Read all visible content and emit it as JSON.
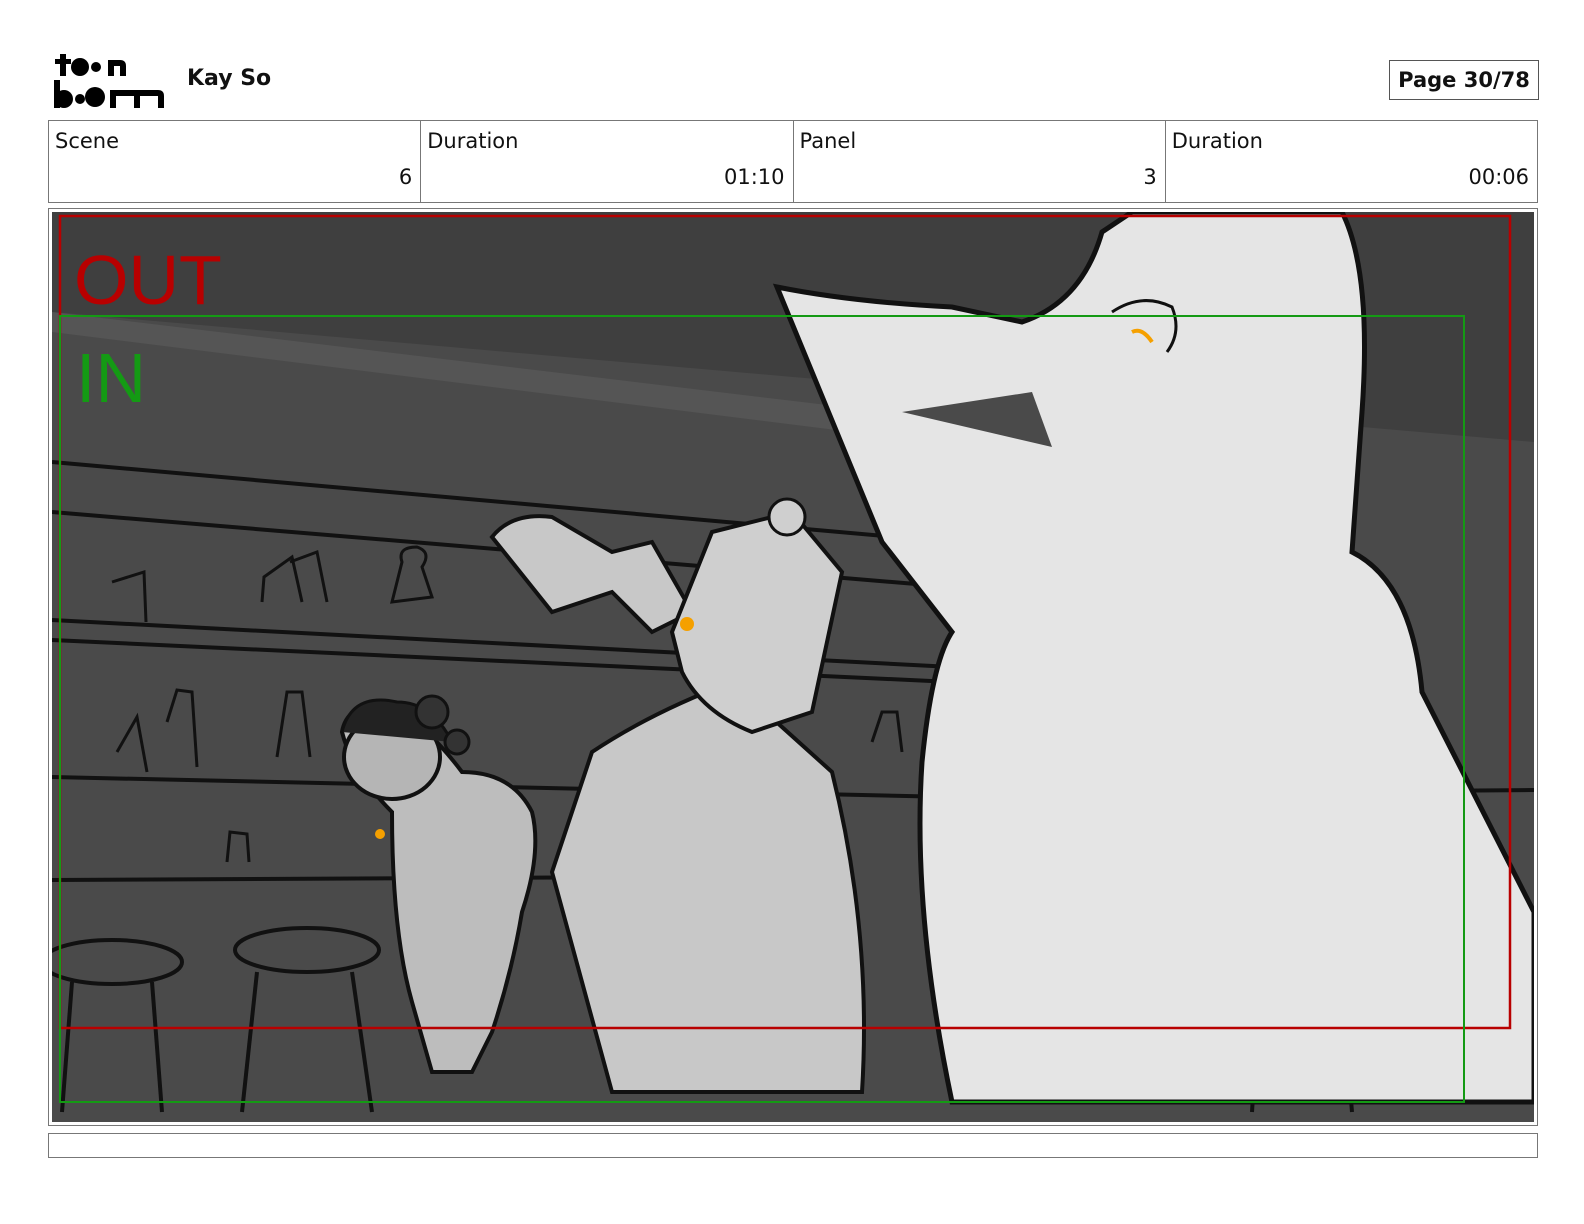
{
  "header": {
    "logo_text": "toon boom",
    "project_name": "Kay So",
    "page_indicator": "Page 30/78"
  },
  "info": {
    "scene_label": "Scene",
    "scene_value": "6",
    "scene_duration_label": "Duration",
    "scene_duration_value": "01:10",
    "panel_label": "Panel",
    "panel_value": "3",
    "panel_duration_label": "Duration",
    "panel_duration_value": "00:06"
  },
  "frame": {
    "out_label": "OUT",
    "in_label": "IN",
    "out_color": "#b80000",
    "in_color": "#149a14",
    "background_color": "#4a4a4a"
  },
  "caption": {
    "text": ""
  }
}
